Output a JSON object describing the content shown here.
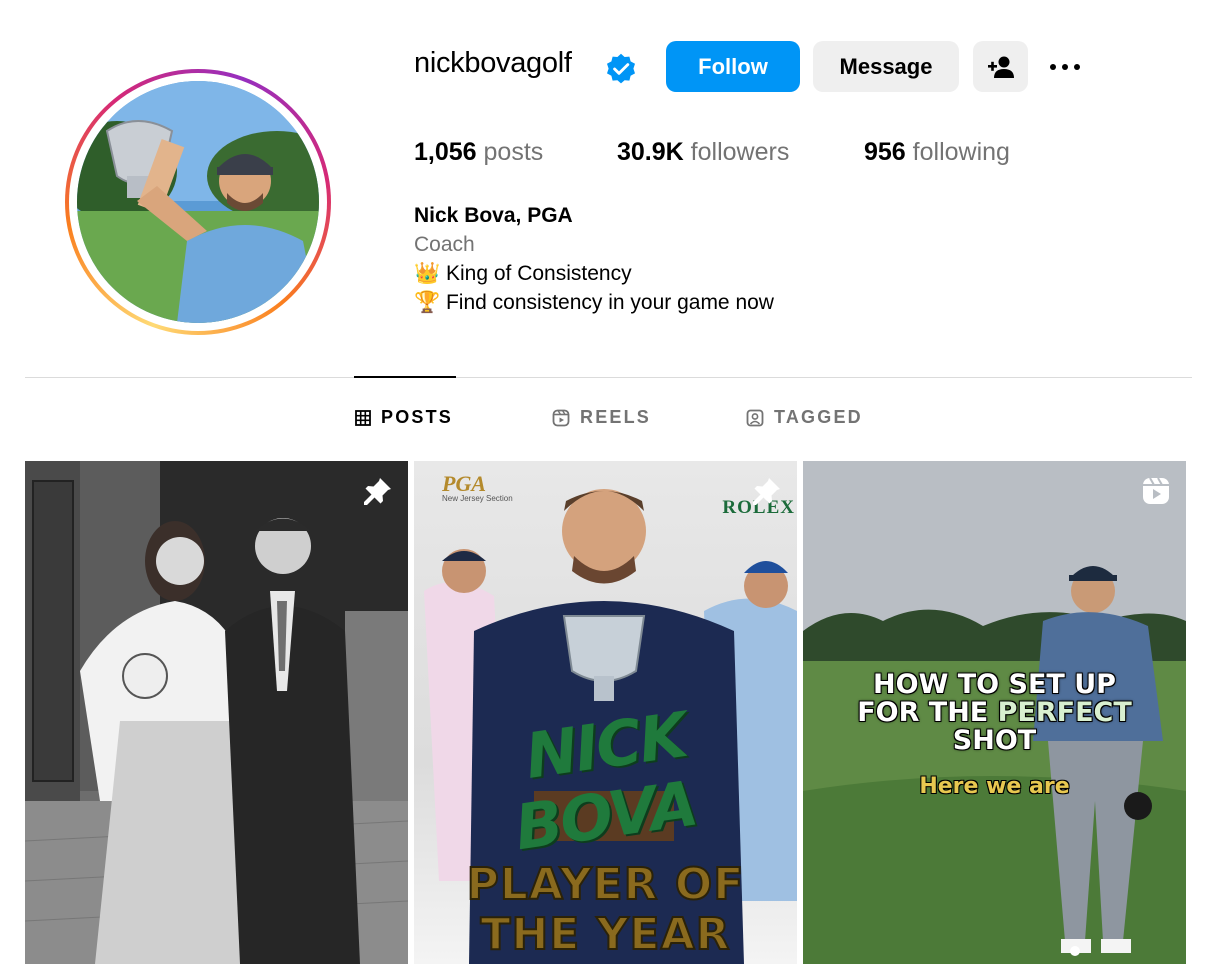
{
  "profile": {
    "username": "nickbovagolf",
    "verified": true,
    "buttons": {
      "follow": "Follow",
      "message": "Message"
    },
    "stats": {
      "posts_count": "1,056",
      "posts_label": "posts",
      "followers_count": "30.9K",
      "followers_label": "followers",
      "following_count": "956",
      "following_label": "following"
    },
    "bio": {
      "name": "Nick Bova, PGA",
      "category": "Coach",
      "line1": "👑 King of Consistency",
      "line2": "🏆 Find consistency in your game now"
    }
  },
  "tabs": [
    {
      "label": "POSTS",
      "icon": "grid-icon",
      "active": true
    },
    {
      "label": "REELS",
      "icon": "reels-icon",
      "active": false
    },
    {
      "label": "TAGGED",
      "icon": "tagged-icon",
      "active": false
    }
  ],
  "posts": [
    {
      "type": "photo",
      "pinned": true,
      "icon": "pin-icon"
    },
    {
      "type": "photo",
      "pinned": true,
      "icon": "pin-icon",
      "overlay": {
        "logo": "PGA",
        "logo_sub": "New Jersey Section",
        "sponsor": "ROLEX",
        "name_line1": "NICK",
        "name_line2": "BOVA",
        "title_line1": "PLAYER OF",
        "title_line2": "THE YEAR"
      }
    },
    {
      "type": "reel",
      "pinned": false,
      "icon": "reel-icon",
      "overlay": {
        "headline_line1": "HOW TO SET UP",
        "headline_line2_a": "FOR THE ",
        "headline_line2_b": "PERFECT",
        "headline_line3": "SHOT",
        "subtitle": "Here we are"
      }
    }
  ],
  "colors": {
    "primary_button": "#0095f6",
    "secondary_button": "#efefef",
    "muted_text": "#737373",
    "divider": "#dbdbdb",
    "verified_badge": "#0095f6"
  }
}
